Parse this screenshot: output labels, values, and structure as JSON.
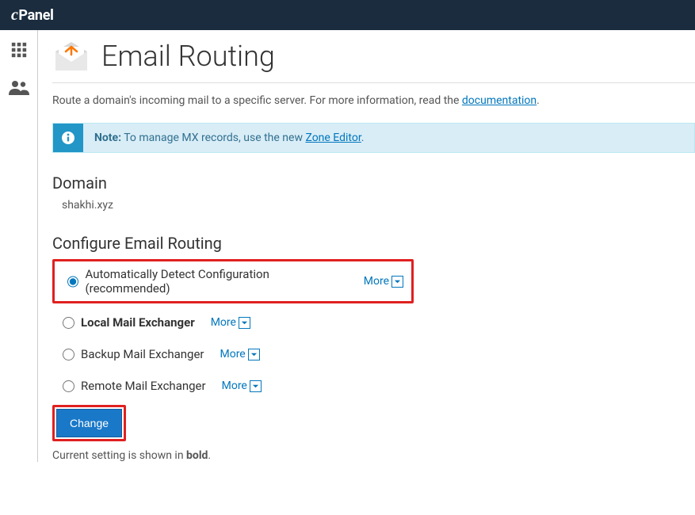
{
  "brand": {
    "c_part": "c",
    "text_part": "Panel"
  },
  "page": {
    "title": "Email Routing",
    "description_pre": "Route a domain's incoming mail to a specific server. For more information, read the ",
    "description_link": "documentation",
    "description_post": "."
  },
  "note": {
    "label": "Note:",
    "text_pre": " To manage MX records, use the new ",
    "link": "Zone Editor",
    "text_post": "."
  },
  "domain": {
    "heading": "Domain",
    "value": "shakhi.xyz"
  },
  "routing": {
    "heading": "Configure Email Routing",
    "more_label": "More",
    "options": [
      {
        "label": "Automatically Detect Configuration (recommended)",
        "checked": true,
        "bold": false,
        "highlighted": true
      },
      {
        "label": "Local Mail Exchanger",
        "checked": false,
        "bold": true,
        "highlighted": false
      },
      {
        "label": "Backup Mail Exchanger",
        "checked": false,
        "bold": false,
        "highlighted": false
      },
      {
        "label": "Remote Mail Exchanger",
        "checked": false,
        "bold": false,
        "highlighted": false
      }
    ],
    "change_button": "Change",
    "hint_pre": "Current setting is shown in ",
    "hint_bold": "bold",
    "hint_post": "."
  }
}
